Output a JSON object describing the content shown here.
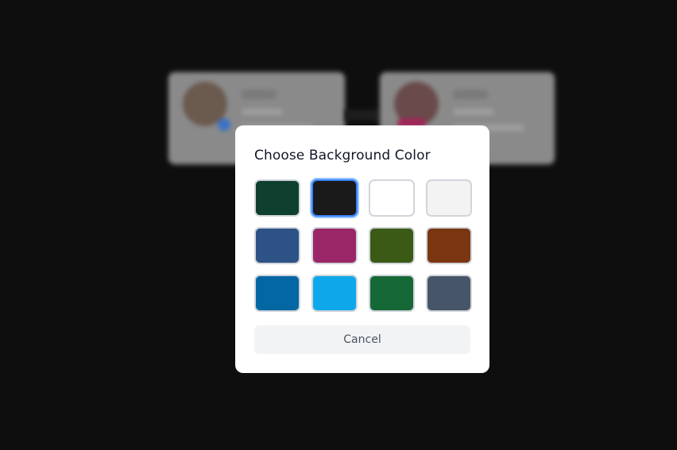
{
  "modal": {
    "title": "Choose Background Color",
    "cancel_label": "Cancel",
    "selected_index": 1,
    "swatches": [
      {
        "name": "dark-green",
        "color": "#0f3f2e"
      },
      {
        "name": "black",
        "color": "#1a1a1a"
      },
      {
        "name": "white",
        "color": "#ffffff"
      },
      {
        "name": "light-gray",
        "color": "#f3f3f3"
      },
      {
        "name": "navy-blue",
        "color": "#2d5286"
      },
      {
        "name": "magenta",
        "color": "#9b2667"
      },
      {
        "name": "olive-green",
        "color": "#3b5a16"
      },
      {
        "name": "rust-brown",
        "color": "#7a3610"
      },
      {
        "name": "ocean-blue",
        "color": "#0367a4"
      },
      {
        "name": "sky-blue",
        "color": "#0ea7ea"
      },
      {
        "name": "forest-green",
        "color": "#166836"
      },
      {
        "name": "slate-gray",
        "color": "#475569"
      }
    ]
  },
  "colors": {
    "backdrop": "#0e0e0e",
    "modal_background": "#ffffff",
    "selected_ring": "#3b82f6"
  }
}
